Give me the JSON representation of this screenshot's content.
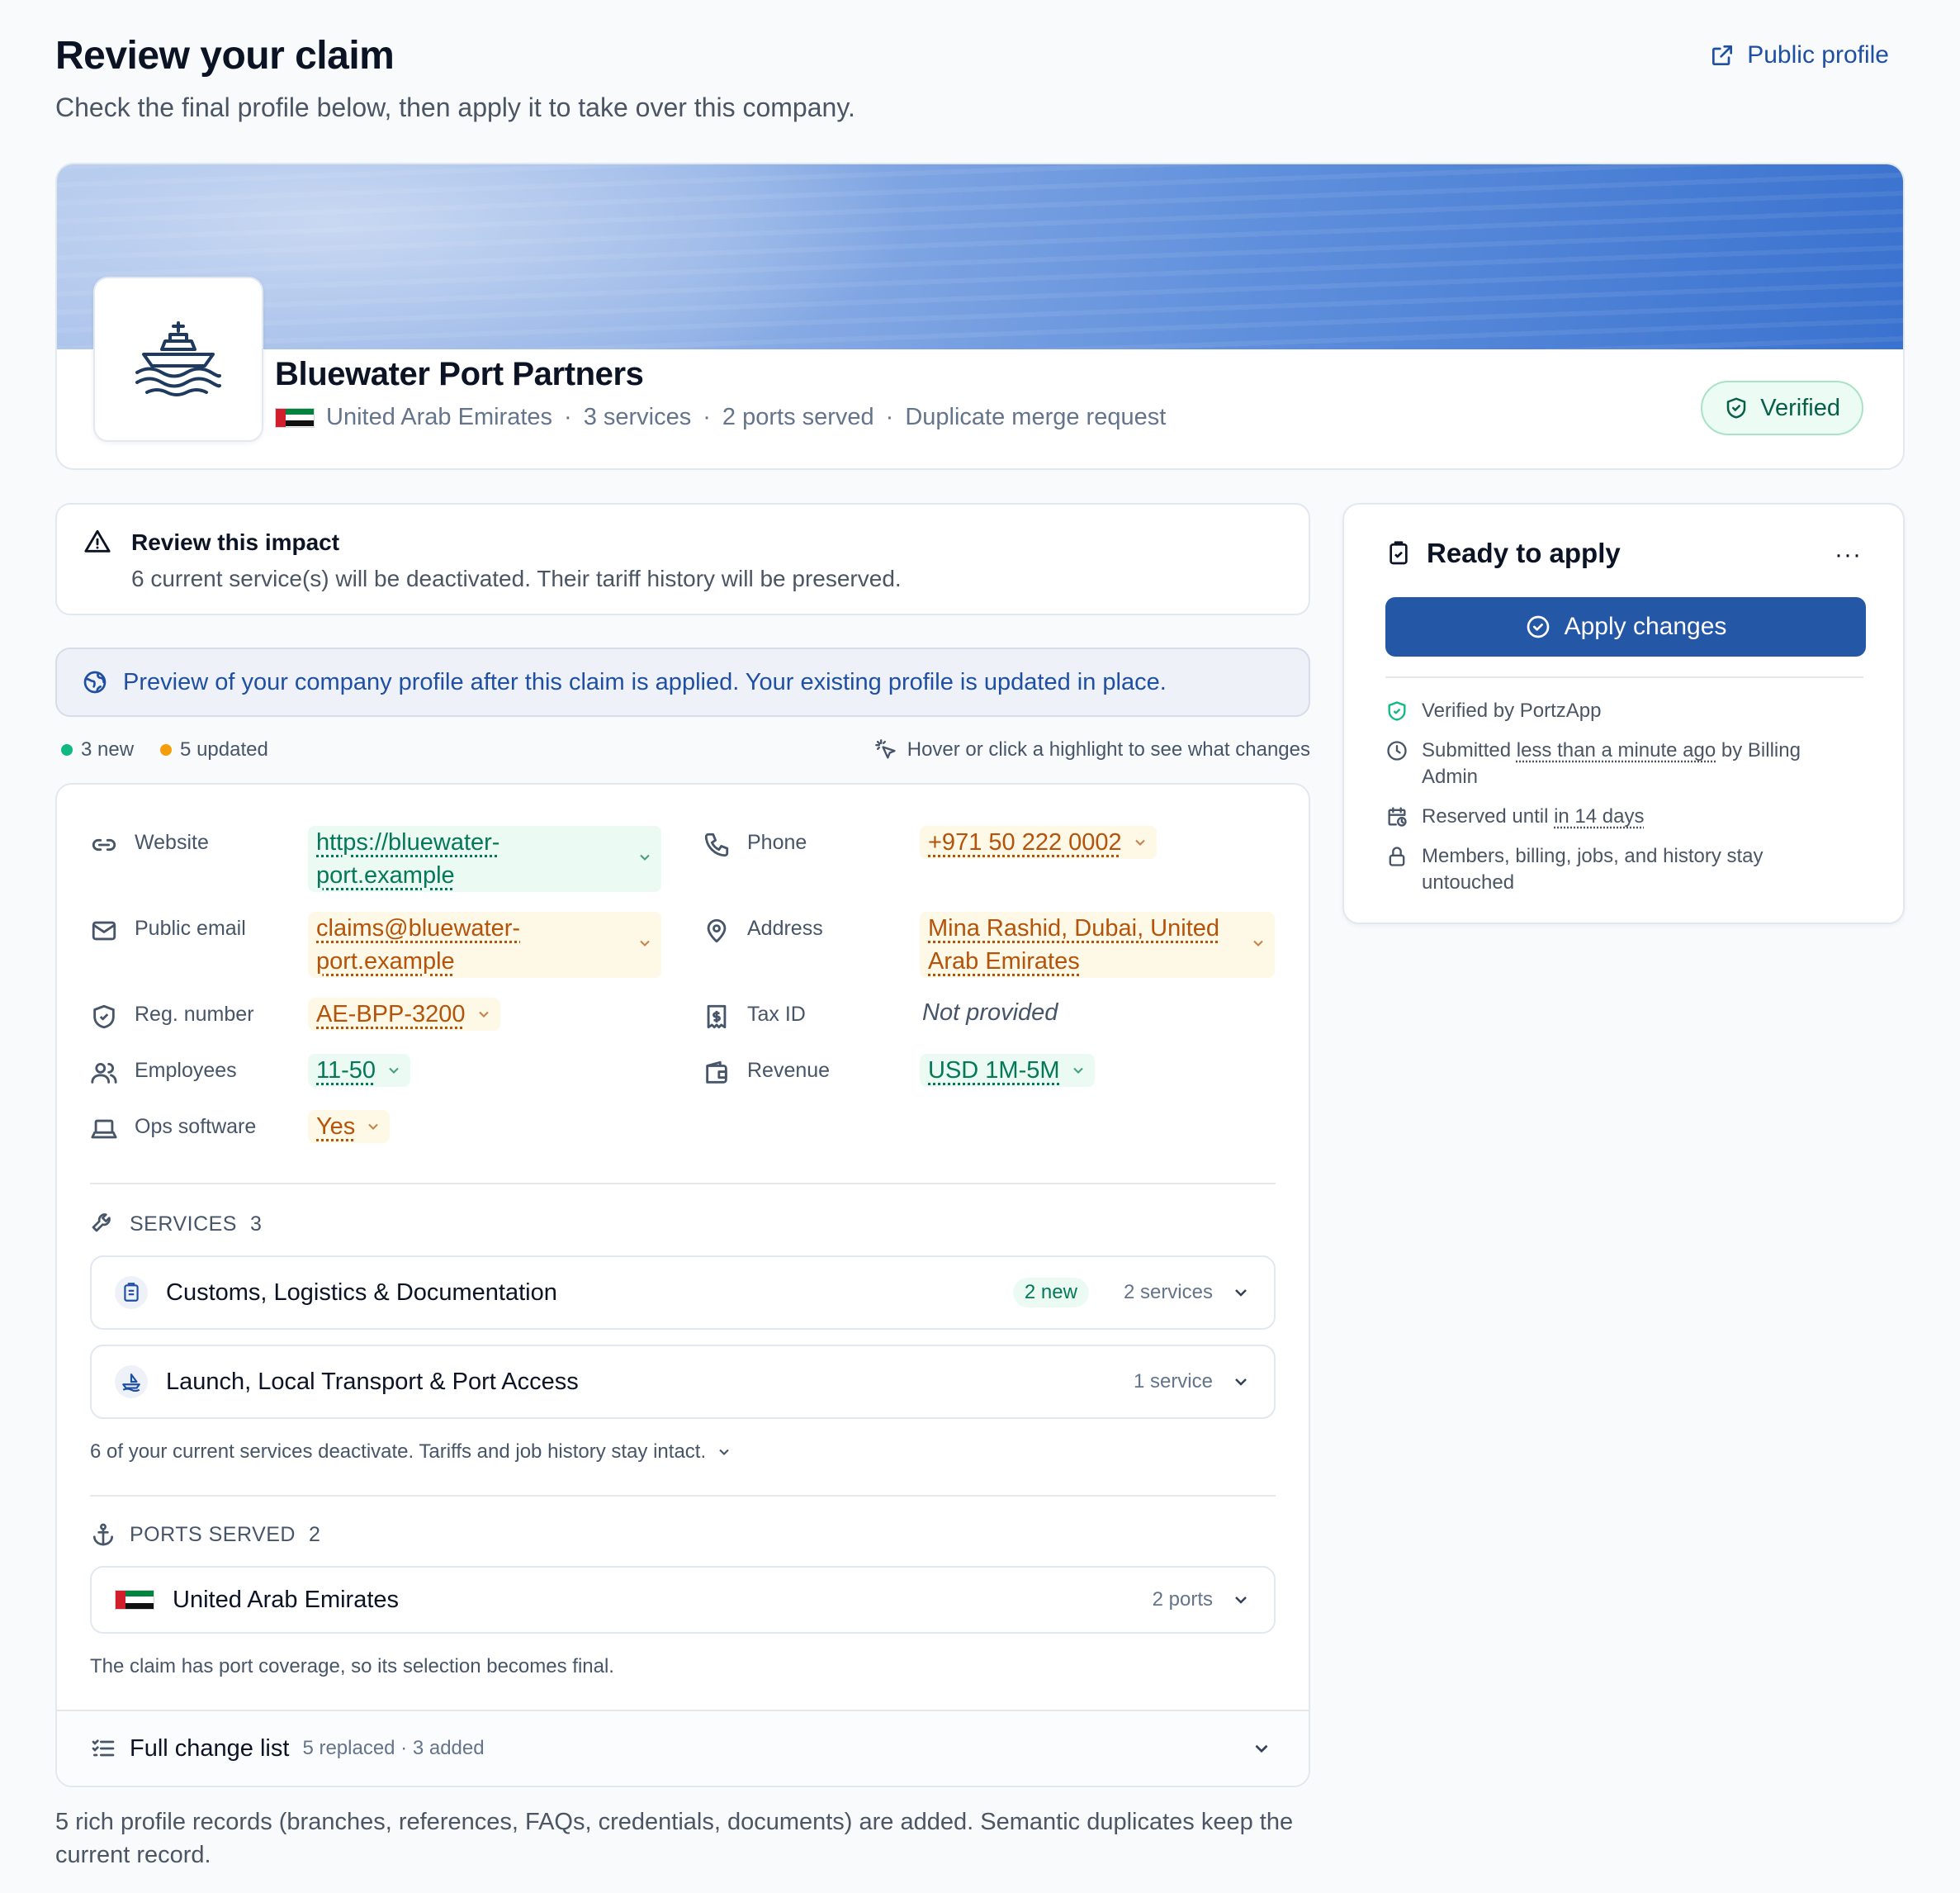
{
  "header": {
    "title": "Review your claim",
    "subtitle": "Check the final profile below, then apply it to take over this company.",
    "public_profile_label": "Public profile"
  },
  "company": {
    "name": "Bluewater Port Partners",
    "country": "United Arab Emirates",
    "services": "3 services",
    "ports": "2 ports served",
    "request_type": "Duplicate merge request",
    "verified_label": "Verified"
  },
  "impact": {
    "heading": "Review this impact",
    "text": "6 current service(s) will be deactivated. Their tariff history will be preserved."
  },
  "preview_note": "Preview of your company profile after this claim is applied. Your existing profile is updated in place.",
  "legend": {
    "new_label": "3 new",
    "updated_label": "5 updated",
    "hint": "Hover or click a highlight to see what changes"
  },
  "fields": {
    "website": {
      "label": "Website",
      "value_line1": "https://bluewater-",
      "value_line2": "port.example"
    },
    "phone": {
      "label": "Phone",
      "value": "+971 50 222 0002"
    },
    "public_email": {
      "label": "Public email",
      "value_line1": "claims@bluewater-",
      "value_line2": "port.example"
    },
    "address": {
      "label": "Address",
      "value_line1": "Mina Rashid, Dubai, United",
      "value_line2": "Arab Emirates"
    },
    "reg_number": {
      "label": "Reg. number",
      "value": "AE-BPP-3200"
    },
    "tax_id": {
      "label": "Tax ID",
      "value": "Not provided"
    },
    "employees": {
      "label": "Employees",
      "value": "11-50"
    },
    "revenue": {
      "label": "Revenue",
      "value": "USD 1M-5M"
    },
    "ops_software": {
      "label": "Ops software",
      "value": "Yes"
    }
  },
  "services": {
    "heading": "SERVICES",
    "count": "3",
    "items": [
      {
        "title": "Customs, Logistics & Documentation",
        "badge": "2 new",
        "count": "2 services"
      },
      {
        "title": "Launch, Local Transport & Port Access",
        "count": "1 service"
      }
    ],
    "note": "6 of your current services deactivate. Tariffs and job history stay intact."
  },
  "ports": {
    "heading": "PORTS SERVED",
    "count": "2",
    "items": [
      {
        "title": "United Arab Emirates",
        "count": "2 ports"
      }
    ],
    "note": "The claim has port coverage, so its selection becomes final."
  },
  "change_list": {
    "title": "Full change list",
    "summary": "5 replaced · 3 added"
  },
  "bottom_note": "5 rich profile records (branches, references, FAQs, credentials, documents) are added. Semantic duplicates keep the current record.",
  "side": {
    "heading": "Ready to apply",
    "more": "···",
    "apply_label": "Apply changes",
    "verified_by": "Verified by PortzApp",
    "submitted_prefix": "Submitted ",
    "submitted_time": "less than a minute ago",
    "submitted_suffix": " by Billing Admin",
    "reserved_prefix": "Reserved until ",
    "reserved_time": "in 14 days",
    "untouched": "Members, billing, jobs, and history stay untouched"
  },
  "colors": {
    "accent": "#2557a7",
    "new": "#047857",
    "updated": "#b45309",
    "verified": "#065f46"
  }
}
